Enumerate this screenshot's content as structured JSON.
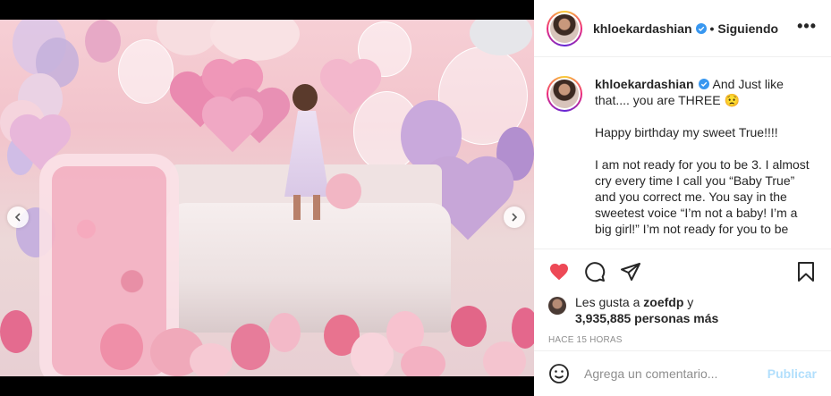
{
  "header": {
    "username": "khloekardashian",
    "separator": "•",
    "follow_status": "Siguiendo",
    "more_label": "•••"
  },
  "caption": {
    "username": "khloekardashian",
    "line1": "And Just like that.... you are THREE 😟",
    "line2": "Happy birthday my sweet True!!!!",
    "line3": "I am not ready for you to be 3. I almost cry every time I call you “Baby True” and you correct me. You say in the sweetest voice “I’m not a baby! I’m a big girl!” I’m not ready for you to be"
  },
  "likes": {
    "prefix": "Les gusta a",
    "liker": "zoefdp",
    "joiner": "y",
    "count": "3,935,885 personas más"
  },
  "timestamp": "HACE 15 HORAS",
  "comment": {
    "placeholder": "Agrega un comentario...",
    "publish_label": "Publicar"
  },
  "icons": {
    "like": "heart-icon",
    "comment": "comment-icon",
    "share": "share-icon",
    "save": "bookmark-icon",
    "emoji": "emoji-icon",
    "verified": "verified-badge-icon",
    "prev": "chevron-left-icon",
    "next": "chevron-right-icon"
  },
  "colors": {
    "like_red": "#ed4956",
    "verified_blue": "#3897f0",
    "publish_disabled": "#b2dffc",
    "muted_text": "#8e8e8e"
  },
  "carousel": {
    "total": 10,
    "active": 1
  }
}
